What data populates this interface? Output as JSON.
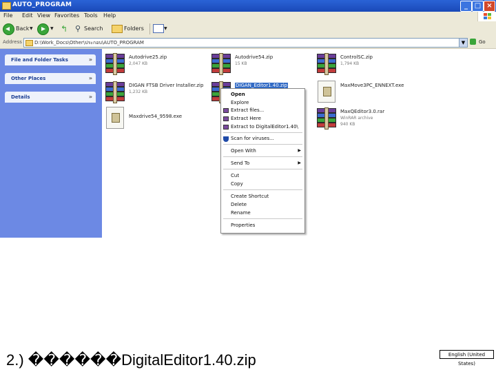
{
  "window": {
    "title": "AUTO_PROGRAM"
  },
  "menubar": {
    "items": [
      "File",
      "Edit",
      "View",
      "Favorites",
      "Tools",
      "Help"
    ]
  },
  "toolbar": {
    "back_label": "Back",
    "search_label": "Search",
    "folders_label": "Folders"
  },
  "address": {
    "label": "Address",
    "path": "D:\\Work_Docs\\Other\\ประกอบ\\AUTO_PROGRAM",
    "go_label": "Go"
  },
  "tasks": {
    "sections": [
      "File and Folder Tasks",
      "Other Places",
      "Details"
    ]
  },
  "files": [
    {
      "name": "Autodrive25.zip",
      "size": "2,047 KB",
      "kind": "zip"
    },
    {
      "name": "Autodrive54.zip",
      "size": "15 KB",
      "kind": "zip"
    },
    {
      "name": "ControlSC.zip",
      "size": "1,794 KB",
      "kind": "zip"
    },
    {
      "name": "DIGAN FTSB Driver Installer.zip",
      "size": "1,232 KB",
      "kind": "zip"
    },
    {
      "name": "DIGAN_Editor1.40.zip",
      "size": "",
      "kind": "zip"
    },
    {
      "name": "MaxMove3PC_ENNEXT.exe",
      "size": "",
      "kind": "exe"
    },
    {
      "name": "Maxdrive54_9598.exe",
      "size": "",
      "kind": "exe"
    },
    {
      "name": "MaxQEditor3.0.rar",
      "line2": "WinRAR archive",
      "size": "940 KB",
      "kind": "zip"
    }
  ],
  "context_menu": {
    "items": [
      "Open",
      "Explore",
      "Extract files...",
      "Extract Here",
      "Extract to DigitalEditor1.40\\",
      "Scan for viruses...",
      "Open With",
      "Send To",
      "Cut",
      "Copy",
      "Create Shortcut",
      "Delete",
      "Rename",
      "Properties"
    ]
  },
  "caption": {
    "text": "2.) ������DigitalEditor1.40.zip"
  },
  "language_button": {
    "label": "English (United States)"
  }
}
